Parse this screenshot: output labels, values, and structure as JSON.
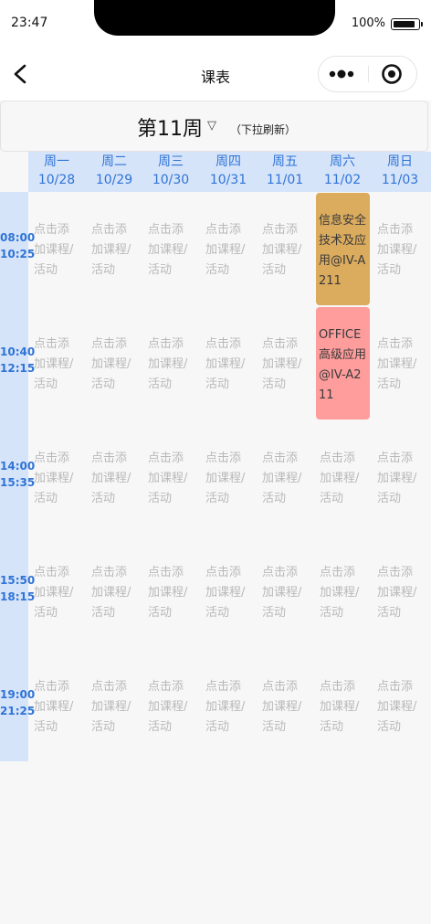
{
  "status_bar": {
    "time": "23:47",
    "battery": "100%"
  },
  "nav": {
    "title": "课表"
  },
  "week": {
    "title": "第11周",
    "arrow": "▽",
    "hint": "（下拉刷新）"
  },
  "days": [
    {
      "name": "周一",
      "date": "10/28"
    },
    {
      "name": "周二",
      "date": "10/29"
    },
    {
      "name": "周三",
      "date": "10/30"
    },
    {
      "name": "周四",
      "date": "10/31"
    },
    {
      "name": "周五",
      "date": "11/01"
    },
    {
      "name": "周六",
      "date": "11/02"
    },
    {
      "name": "周日",
      "date": "11/03"
    }
  ],
  "periods": [
    {
      "start": "08:00",
      "end": "10:25"
    },
    {
      "start": "10:40",
      "end": "12:15"
    },
    {
      "start": "14:00",
      "end": "15:35"
    },
    {
      "start": "15:50",
      "end": "18:15"
    },
    {
      "start": "19:00",
      "end": "21:25"
    }
  ],
  "empty_cell_text": "点击添加课程/活动",
  "courses": [
    {
      "day": 5,
      "period": 0,
      "text": "信息安全技术及应用@IV-A211",
      "color": "#dbab5e"
    },
    {
      "day": 5,
      "period": 1,
      "text": "OFFICE高级应用@IV-A211",
      "color": "#ff9c9c"
    }
  ]
}
